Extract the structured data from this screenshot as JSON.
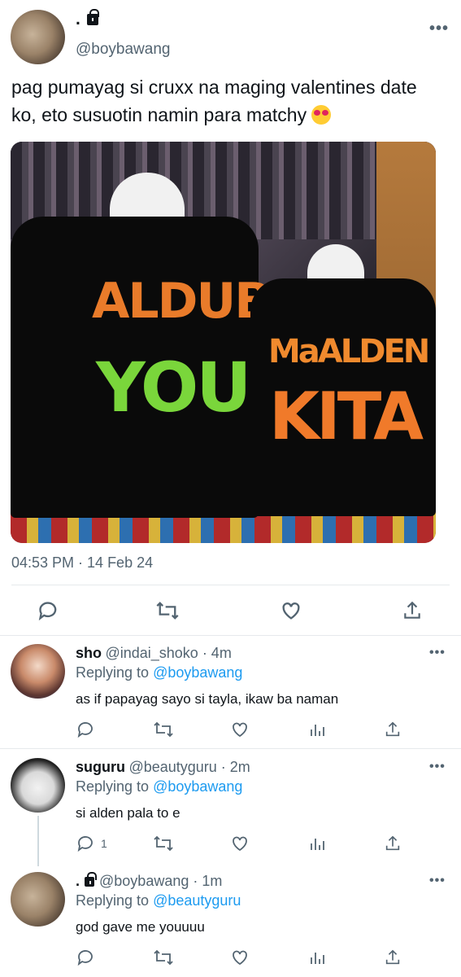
{
  "main_tweet": {
    "display_name": ".",
    "handle": "@boybawang",
    "text": "pag pumayag si cruxx na maging valentines date ko, eto susuotin namin para matchy",
    "photo": {
      "left_shirt_line1": "ALDUB",
      "left_shirt_line2": "YOU",
      "right_shirt_line1": "MaALDEN",
      "right_shirt_line2": "KITA"
    },
    "timestamp": "04:53 PM · 14 Feb 24"
  },
  "replies": [
    {
      "name": "sho",
      "handle": "@indai_shoko · 4m",
      "replying_prefix": "Replying to ",
      "replying_to": "@boybawang",
      "text": "as if papayag sayo si tayla, ikaw ba naman",
      "reply_count": ""
    },
    {
      "name": "suguru",
      "handle": "@beautyguru · 2m",
      "replying_prefix": "Replying to ",
      "replying_to": "@boybawang",
      "text": "si alden pala to e",
      "reply_count": "1"
    },
    {
      "name": ".",
      "handle": "@boybawang · 1m",
      "replying_prefix": "Replying to ",
      "replying_to": "@beautyguru",
      "text": "god gave me youuuu",
      "reply_count": ""
    }
  ],
  "more_label": "•••",
  "colors": {
    "link": "#1d9bf0",
    "secondary": "#536471",
    "text": "#0f1419"
  }
}
